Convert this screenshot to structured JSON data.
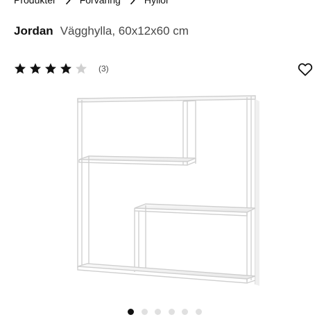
{
  "breadcrumb": {
    "items": [
      {
        "label": "Produkter"
      },
      {
        "label": "Förvaring"
      },
      {
        "label": "Hyllor"
      }
    ]
  },
  "product": {
    "name": "Jordan",
    "description": "Vägghylla, 60x12x60 cm"
  },
  "rating": {
    "value": 4,
    "max": 5,
    "review_count": "(3)",
    "icon": "star-icon",
    "filled_color": "#111111",
    "empty_color": "#cfcfcf"
  },
  "favorite": {
    "icon": "heart-icon"
  },
  "gallery": {
    "total_images": 6,
    "active_index": 0
  }
}
